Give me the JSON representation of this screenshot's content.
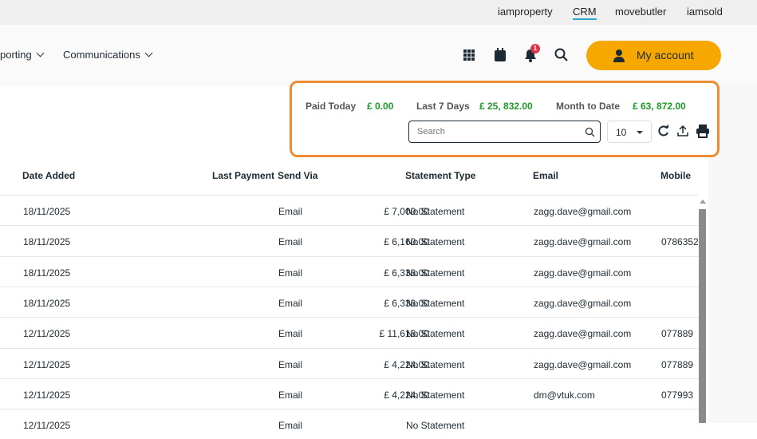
{
  "topbar": {
    "links": [
      "iamproperty",
      "CRM",
      "movebutler",
      "iamsold"
    ],
    "active": "CRM"
  },
  "nav": {
    "menus": [
      "porting",
      "Communications"
    ],
    "notification_count": "1",
    "account_label": "My account"
  },
  "stats": {
    "paid_today_label": "Paid Today",
    "paid_today": "£ 0.00",
    "last7_label": "Last 7 Days",
    "last7": "£ 25, 832.00",
    "mtd_label": "Month to Date",
    "mtd": "£ 63, 872.00"
  },
  "toolbar": {
    "search_placeholder": "Search",
    "page_size": "10"
  },
  "colors": {
    "accent": "#f6a800",
    "highlight": "#ec8d35",
    "money": "#1d9a2a"
  },
  "table": {
    "headers": [
      "Date Added",
      "Last Payment",
      "Send Via",
      "Statement Type",
      "Email",
      "Mobile"
    ],
    "rows": [
      [
        "18/11/2025",
        "£ 7,000.00",
        "Email",
        "No Statement",
        "zagg.dave@gmail.com",
        ""
      ],
      [
        "18/11/2025",
        "£ 6,160.00",
        "Email",
        "No Statement",
        "zagg.dave@gmail.com",
        "0786352"
      ],
      [
        "18/11/2025",
        "£ 6,336.00",
        "Email",
        "No Statement",
        "zagg.dave@gmail.com",
        ""
      ],
      [
        "18/11/2025",
        "£ 6,336.00",
        "Email",
        "No Statement",
        "zagg.dave@gmail.com",
        ""
      ],
      [
        "12/11/2025",
        "£ 11,616.00",
        "Email",
        "No Statement",
        "zagg.dave@gmail.com",
        "077889"
      ],
      [
        "12/11/2025",
        "£ 4,224.00",
        "Email",
        "No Statement",
        "zagg.dave@gmail.com",
        "077889"
      ],
      [
        "12/11/2025",
        "£ 4,224.00",
        "Email",
        "No Statement",
        "dm@vtuk.com",
        "077993"
      ],
      [
        "12/11/2025",
        "",
        "Email",
        "No Statement",
        "",
        ""
      ]
    ]
  }
}
